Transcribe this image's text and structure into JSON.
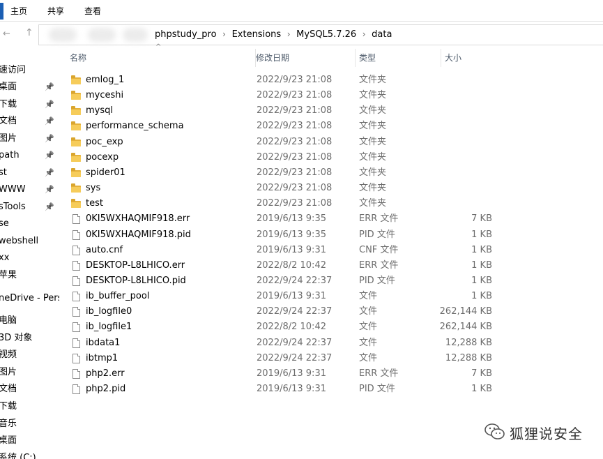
{
  "ribbon": {
    "tabs": [
      "主页",
      "共享",
      "查看"
    ]
  },
  "address": {
    "back_icon": "back-arrow-icon",
    "up_icon": "up-arrow-icon",
    "crumbs": [
      "phpstudy_pro",
      "Extensions",
      "MySQL5.7.26",
      "data"
    ]
  },
  "nav": {
    "items": [
      {
        "label": "速访问",
        "pinned": false
      },
      {
        "label": "桌面",
        "pinned": true
      },
      {
        "label": "下载",
        "pinned": true
      },
      {
        "label": "文档",
        "pinned": true
      },
      {
        "label": "图片",
        "pinned": true
      },
      {
        "label": "path",
        "pinned": true
      },
      {
        "label": "st",
        "pinned": true
      },
      {
        "label": "WWW",
        "pinned": true
      },
      {
        "label": "sTools",
        "pinned": true
      },
      {
        "label": "se",
        "pinned": false
      },
      {
        "label": "webshell",
        "pinned": false
      },
      {
        "label": "xx",
        "pinned": false
      },
      {
        "label": "苹果",
        "pinned": false
      },
      {
        "label": "neDrive - Pers",
        "pinned": false
      },
      {
        "label": "电脑",
        "pinned": false
      },
      {
        "label": "3D 对象",
        "pinned": false
      },
      {
        "label": "视频",
        "pinned": false
      },
      {
        "label": "图片",
        "pinned": false
      },
      {
        "label": "文档",
        "pinned": false
      },
      {
        "label": "下载",
        "pinned": false
      },
      {
        "label": "音乐",
        "pinned": false
      },
      {
        "label": "桌面",
        "pinned": false
      },
      {
        "label": "系统 (C:)",
        "pinned": false
      }
    ]
  },
  "columns": {
    "name": "名称",
    "date": "修改日期",
    "type": "类型",
    "size": "大小"
  },
  "files": [
    {
      "name": "emlog_1",
      "date": "2022/9/23 21:08",
      "type": "文件夹",
      "size": "",
      "kind": "folder"
    },
    {
      "name": "myceshi",
      "date": "2022/9/23 21:08",
      "type": "文件夹",
      "size": "",
      "kind": "folder"
    },
    {
      "name": "mysql",
      "date": "2022/9/23 21:08",
      "type": "文件夹",
      "size": "",
      "kind": "folder"
    },
    {
      "name": "performance_schema",
      "date": "2022/9/23 21:08",
      "type": "文件夹",
      "size": "",
      "kind": "folder"
    },
    {
      "name": "poc_exp",
      "date": "2022/9/23 21:08",
      "type": "文件夹",
      "size": "",
      "kind": "folder"
    },
    {
      "name": "pocexp",
      "date": "2022/9/23 21:08",
      "type": "文件夹",
      "size": "",
      "kind": "folder"
    },
    {
      "name": "spider01",
      "date": "2022/9/23 21:08",
      "type": "文件夹",
      "size": "",
      "kind": "folder"
    },
    {
      "name": "sys",
      "date": "2022/9/23 21:08",
      "type": "文件夹",
      "size": "",
      "kind": "folder"
    },
    {
      "name": "test",
      "date": "2022/9/23 21:08",
      "type": "文件夹",
      "size": "",
      "kind": "folder"
    },
    {
      "name": "0KI5WXHAQMIF918.err",
      "date": "2019/6/13 9:35",
      "type": "ERR 文件",
      "size": "7 KB",
      "kind": "file"
    },
    {
      "name": "0KI5WXHAQMIF918.pid",
      "date": "2019/6/13 9:35",
      "type": "PID 文件",
      "size": "1 KB",
      "kind": "file"
    },
    {
      "name": "auto.cnf",
      "date": "2019/6/13 9:31",
      "type": "CNF 文件",
      "size": "1 KB",
      "kind": "file"
    },
    {
      "name": "DESKTOP-L8LHICO.err",
      "date": "2022/8/2 10:42",
      "type": "ERR 文件",
      "size": "1 KB",
      "kind": "file"
    },
    {
      "name": "DESKTOP-L8LHICO.pid",
      "date": "2022/9/24 22:37",
      "type": "PID 文件",
      "size": "1 KB",
      "kind": "file"
    },
    {
      "name": "ib_buffer_pool",
      "date": "2019/6/13 9:31",
      "type": "文件",
      "size": "1 KB",
      "kind": "file"
    },
    {
      "name": "ib_logfile0",
      "date": "2022/9/24 22:37",
      "type": "文件",
      "size": "262,144 KB",
      "kind": "file"
    },
    {
      "name": "ib_logfile1",
      "date": "2022/8/2 10:42",
      "type": "文件",
      "size": "262,144 KB",
      "kind": "file"
    },
    {
      "name": "ibdata1",
      "date": "2022/9/24 22:37",
      "type": "文件",
      "size": "12,288 KB",
      "kind": "file"
    },
    {
      "name": "ibtmp1",
      "date": "2022/9/24 22:37",
      "type": "文件",
      "size": "12,288 KB",
      "kind": "file"
    },
    {
      "name": "php2.err",
      "date": "2019/6/13 9:31",
      "type": "ERR 文件",
      "size": "7 KB",
      "kind": "file"
    },
    {
      "name": "php2.pid",
      "date": "2019/6/13 9:31",
      "type": "PID 文件",
      "size": "1 KB",
      "kind": "file"
    }
  ],
  "watermark": {
    "text": "狐狸说安全",
    "icon": "wechat-logo-icon"
  },
  "colors": {
    "folder": "#f6cc5a",
    "active_tab": "#1b5fb4",
    "secondary_text": "#6d6d6d"
  }
}
